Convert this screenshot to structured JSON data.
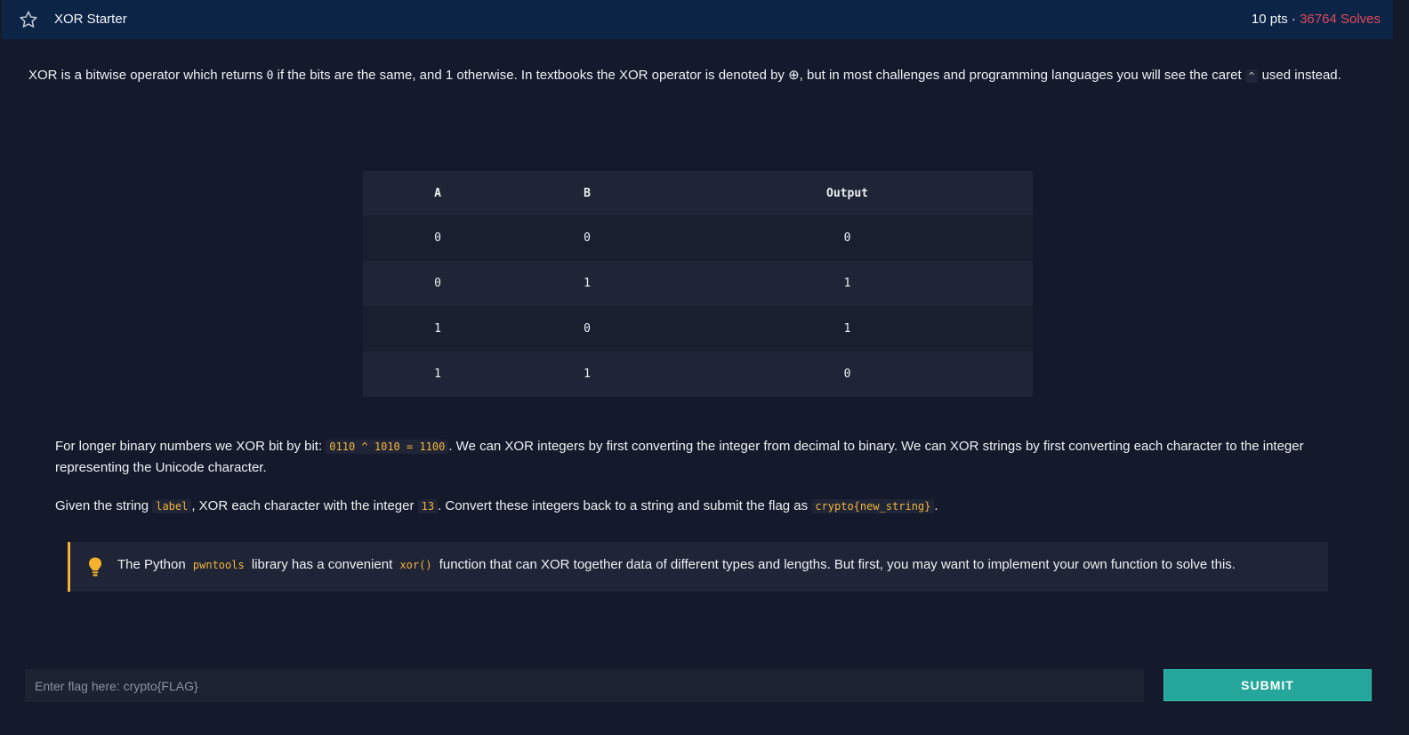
{
  "header": {
    "title": "XOR Starter",
    "points": "10 pts",
    "separator": "·",
    "solves": "36764 Solves",
    "icon": "star-icon"
  },
  "intro": {
    "t1": "XOR is a bitwise operator which returns ",
    "zero": "0",
    "t2": " if the bits are the same, and 1 otherwise. In textbooks the XOR operator is denoted by ⊕, but in most challenges and programming languages you will see the caret ",
    "caret": "^",
    "t3": " used instead."
  },
  "table": {
    "headers": [
      "A",
      "B",
      "Output"
    ],
    "rows": [
      [
        "0",
        "0",
        "0"
      ],
      [
        "0",
        "1",
        "1"
      ],
      [
        "1",
        "0",
        "1"
      ],
      [
        "1",
        "1",
        "0"
      ]
    ]
  },
  "para1": {
    "t1": "For longer binary numbers we XOR bit by bit: ",
    "code": "0110 ^ 1010 = 1100",
    "t2": ". We can XOR integers by first converting the integer from decimal to binary. We can XOR strings by first converting each character to the in­teger representing the Unicode character."
  },
  "para2": {
    "t1": "Given the string ",
    "code1": "label",
    "t2": ", XOR each character with the integer ",
    "code2": "13",
    "t3": ". Convert these integers back to a string and submit the flag as ",
    "code3": "crypto{new_string}",
    "t4": "."
  },
  "hint": {
    "icon": "lightbulb-icon",
    "t1": "The Python ",
    "code1": "pwntools",
    "t2": " library has a convenient ",
    "code2": "xor()",
    "t3": " function that can XOR together data of different types and lengths. But first, you may want to implement your own function to solve this."
  },
  "form": {
    "placeholder": "Enter flag here: crypto{FLAG}",
    "submit_label": "SUBMIT"
  },
  "colors": {
    "header_bg": "#0c2547",
    "page_bg": "#141a2b",
    "solves": "#e0495a",
    "code": "#f5b53c",
    "hint_border": "#f2b233",
    "submit_bg": "#24a69a"
  }
}
